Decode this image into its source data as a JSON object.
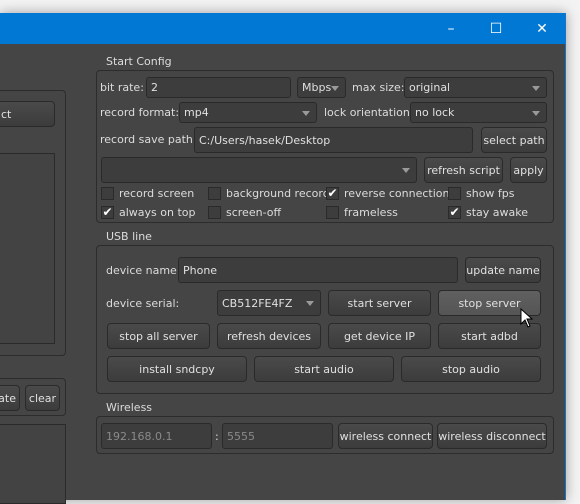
{
  "window": {
    "minimize": "–",
    "maximize": "☐",
    "close": "✕"
  },
  "left": {
    "top_button": "ct",
    "update_button": "ate",
    "clear_button": "clear"
  },
  "start_config": {
    "title": "Start Config",
    "bit_rate_label": "bit rate:",
    "bit_rate_value": "2",
    "bit_rate_unit": "Mbps",
    "max_size_label": "max size:",
    "max_size_value": "original",
    "record_format_label": "record format:",
    "record_format_value": "mp4",
    "lock_orientation_label": "lock orientation:",
    "lock_orientation_value": "no lock",
    "save_path_label": "record save path:",
    "save_path_value": "C:/Users/hasek/Desktop",
    "select_path": "select path",
    "script_value": "",
    "refresh_script": "refresh script",
    "apply": "apply",
    "checkboxes": [
      {
        "label": "record screen",
        "checked": false
      },
      {
        "label": "background record",
        "checked": false
      },
      {
        "label": "reverse connection",
        "checked": true
      },
      {
        "label": "show fps",
        "checked": false
      },
      {
        "label": "always on top",
        "checked": true
      },
      {
        "label": "screen-off",
        "checked": false
      },
      {
        "label": "frameless",
        "checked": false
      },
      {
        "label": "stay awake",
        "checked": true
      }
    ]
  },
  "usb": {
    "title": "USB line",
    "device_name_label": "device name:",
    "device_name_value": "Phone",
    "update_name": "update name",
    "device_serial_label": "device serial:",
    "device_serial_value": "CB512FE4FZ",
    "start_server": "start server",
    "stop_server": "stop server",
    "stop_all_server": "stop all server",
    "refresh_devices": "refresh devices",
    "get_device_ip": "get device IP",
    "start_adbd": "start adbd",
    "install_sndcpy": "install sndcpy",
    "start_audio": "start audio",
    "stop_audio": "stop audio"
  },
  "wireless": {
    "title": "Wireless",
    "ip_placeholder": "192.168.0.1",
    "separator": ":",
    "port_placeholder": "5555",
    "connect": "wireless connect",
    "disconnect": "wireless disconnect"
  }
}
